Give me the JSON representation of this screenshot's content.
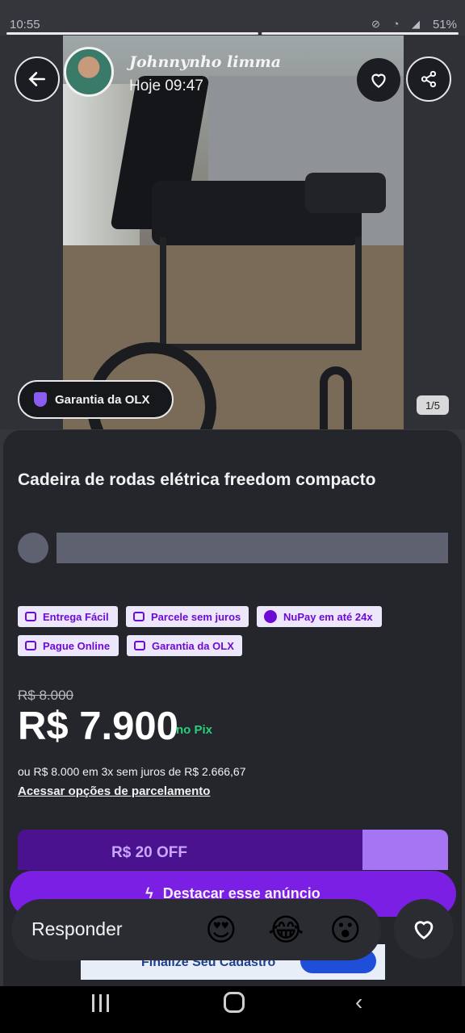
{
  "status_bar": {
    "time": "10:55",
    "battery": "51%"
  },
  "story": {
    "user_name": "Johnnynho limma",
    "posted": "Hoje 09:47",
    "reply_placeholder": "Responder",
    "reactions": [
      "😍",
      "😂",
      "😮"
    ]
  },
  "listing": {
    "warranty_badge": "Garantia da OLX",
    "photo_counter": "1/5",
    "title": "Cadeira de rodas elétrica freedom compacto",
    "chips": [
      "Entrega Fácil",
      "Parcele sem juros",
      "NuPay em até 24x",
      "Pague Online",
      "Garantia da OLX"
    ],
    "old_price": "R$ 8.000",
    "price": "R$ 7.900",
    "price_note": "no Pix",
    "installments": "ou R$ 8.000 em 3x sem juros de R$ 2.666,67",
    "installments_link": "Acessar opções de parcelamento",
    "discount_banner": "R$ 20 OFF",
    "highlight_button": "Destacar esse anúncio"
  },
  "ad": {
    "text": "Finalize Seu Cadastro"
  },
  "colors": {
    "brand_purple": "#6e0ad6",
    "pix_green": "#27d07a",
    "sheet_bg": "#24262b"
  },
  "icons": [
    "back-arrow-icon",
    "heart-icon",
    "share-icon",
    "shield-icon",
    "recents-icon",
    "home-icon",
    "nav-back-icon"
  ]
}
